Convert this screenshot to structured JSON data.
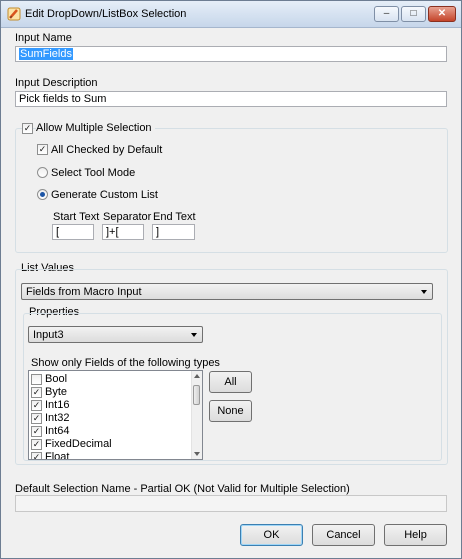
{
  "window": {
    "title": "Edit DropDown/ListBox Selection",
    "buttons": {
      "minimize": "–",
      "maximize": "□",
      "close": "✕"
    }
  },
  "input_name": {
    "label": "Input Name",
    "value": "SumFields"
  },
  "input_description": {
    "label": "Input Description",
    "value": "Pick fields to Sum"
  },
  "allow_multiple": {
    "label": "Allow Multiple Selection",
    "checked": true
  },
  "all_checked": {
    "label": "All Checked by Default",
    "checked": true
  },
  "select_tool_mode": {
    "label": "Select Tool Mode",
    "selected": false
  },
  "generate_custom_list": {
    "label": "Generate Custom List",
    "selected": true
  },
  "custom_list": {
    "start_text_label": "Start Text",
    "start_text_value": "[",
    "separator_label": "Separator",
    "separator_value": "]+[",
    "end_text_label": "End Text",
    "end_text_value": "]"
  },
  "list_values": {
    "label": "List Values",
    "selected": "Fields from Macro Input"
  },
  "properties": {
    "label": "Properties",
    "input_selected": "Input3",
    "types_label": "Show only Fields of the following types",
    "types": [
      {
        "label": "Bool",
        "checked": false
      },
      {
        "label": "Byte",
        "checked": true
      },
      {
        "label": "Int16",
        "checked": true
      },
      {
        "label": "Int32",
        "checked": true
      },
      {
        "label": "Int64",
        "checked": true
      },
      {
        "label": "FixedDecimal",
        "checked": true
      },
      {
        "label": "Float",
        "checked": true
      }
    ],
    "all_button": "All",
    "none_button": "None"
  },
  "default_selection": {
    "label": "Default Selection Name - Partial OK (Not Valid for Multiple Selection)",
    "value": ""
  },
  "footer": {
    "ok": "OK",
    "cancel": "Cancel",
    "help": "Help"
  },
  "colors": {
    "selection": "#3399ff",
    "title_gradient_top": "#e6eef8",
    "title_gradient_bottom": "#c6d6ea"
  }
}
